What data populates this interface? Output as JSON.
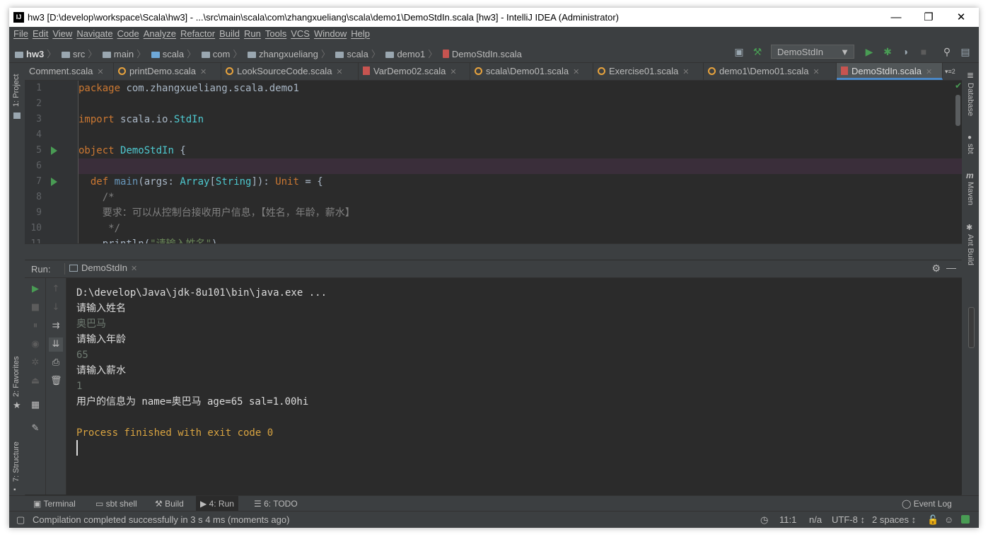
{
  "window": {
    "title": "hw3 [D:\\develop\\workspace\\Scala\\hw3] - ...\\src\\main\\scala\\com\\zhangxueliang\\scala\\demo1\\DemoStdIn.scala [hw3] - IntelliJ IDEA (Administrator)",
    "app_icon": "IJ",
    "minimize": "—",
    "restore": "❐",
    "close": "✕"
  },
  "menu": [
    "File",
    "Edit",
    "View",
    "Navigate",
    "Code",
    "Analyze",
    "Refactor",
    "Build",
    "Run",
    "Tools",
    "VCS",
    "Window",
    "Help"
  ],
  "breadcrumb": [
    "hw3",
    "src",
    "main",
    "scala",
    "com",
    "zhangxueliang",
    "scala",
    "demo1",
    "DemoStdIn.scala"
  ],
  "run_config": "DemoStdIn",
  "tabs": [
    {
      "label": "Comment.scala",
      "icon": "scala-object-icon"
    },
    {
      "label": "printDemo.scala",
      "icon": "scala-object-icon"
    },
    {
      "label": "LookSourceCode.scala",
      "icon": "scala-object-icon"
    },
    {
      "label": "VarDemo02.scala",
      "icon": "scala-file-icon"
    },
    {
      "label": "scala\\Demo01.scala",
      "icon": "scala-object-icon"
    },
    {
      "label": "Exercise01.scala",
      "icon": "scala-object-icon"
    },
    {
      "label": "demo1\\Demo01.scala",
      "icon": "scala-object-icon"
    },
    {
      "label": "DemoStdIn.scala",
      "icon": "scala-file-icon",
      "active": true
    }
  ],
  "tabs_overflow": "▾≡2",
  "side_left": [
    "1: Project",
    "2: Favorites",
    "7: Structure"
  ],
  "side_right": [
    "Database",
    "sbt",
    "Maven",
    "Ant Build"
  ],
  "editor_lines": [
    {
      "n": "1",
      "tokens": [
        [
          "kw",
          "package "
        ],
        [
          "plain",
          "com.zhangxueliang.scala.demo1"
        ]
      ]
    },
    {
      "n": "2",
      "tokens": []
    },
    {
      "n": "3",
      "tokens": [
        [
          "kw",
          "import "
        ],
        [
          "plain",
          "scala.io."
        ],
        [
          "ty",
          "StdIn"
        ]
      ]
    },
    {
      "n": "4",
      "tokens": []
    },
    {
      "n": "5",
      "tokens": [
        [
          "kw",
          "object "
        ],
        [
          "ty",
          "DemoStdIn "
        ],
        [
          "plain",
          "{"
        ]
      ],
      "run": true
    },
    {
      "n": "6",
      "tokens": [],
      "current": true
    },
    {
      "n": "7",
      "tokens": [
        [
          "kw",
          "  def "
        ],
        [
          "fn",
          "main"
        ],
        [
          "plain",
          "(args: "
        ],
        [
          "ty",
          "Array"
        ],
        [
          "plain",
          "["
        ],
        [
          "ty",
          "String"
        ],
        [
          "plain",
          "]): "
        ],
        [
          "kw",
          "Unit"
        ],
        [
          "plain",
          " = {"
        ]
      ],
      "run": true
    },
    {
      "n": "8",
      "tokens": [
        [
          "cm",
          "    /*"
        ]
      ]
    },
    {
      "n": "9",
      "tokens": [
        [
          "cm",
          "    要求：可以从控制台接收用户信息，【姓名，年龄，薪水】"
        ]
      ]
    },
    {
      "n": "10",
      "tokens": [
        [
          "cm",
          "     */"
        ]
      ]
    },
    {
      "n": "11",
      "tokens": [
        [
          "plain",
          "    println("
        ],
        [
          "str",
          "\"请输入姓名\""
        ],
        [
          "plain",
          ")"
        ]
      ]
    }
  ],
  "run_panel": {
    "label": "Run:",
    "tab": "DemoStdIn",
    "console": [
      {
        "type": "out",
        "text": "D:\\develop\\Java\\jdk-8u101\\bin\\java.exe ..."
      },
      {
        "type": "out",
        "text": "请输入姓名"
      },
      {
        "type": "in",
        "text": "奥巴马"
      },
      {
        "type": "out",
        "text": "请输入年龄"
      },
      {
        "type": "in",
        "text": "65"
      },
      {
        "type": "out",
        "text": "请输入薪水"
      },
      {
        "type": "in",
        "text": "1"
      },
      {
        "type": "out",
        "text": "用户的信息为 name=奥巴马 age=65 sal=1.00hi"
      },
      {
        "type": "out",
        "text": ""
      },
      {
        "type": "done",
        "text": "Process finished with exit code 0"
      }
    ]
  },
  "bottom_tabs": [
    "Terminal",
    "sbt shell",
    "Build",
    "4: Run",
    "6: TODO"
  ],
  "event_log": "Event Log",
  "status": {
    "message": "Compilation completed successfully in 3 s 4 ms (moments ago)",
    "position": "11:1",
    "na": "n/a",
    "encoding": "UTF-8 ↕",
    "indent": "2 spaces ↕"
  },
  "colors": {
    "accent": "#4a88c7",
    "run_green": "#499c54",
    "exit_text": "#d9a441"
  }
}
